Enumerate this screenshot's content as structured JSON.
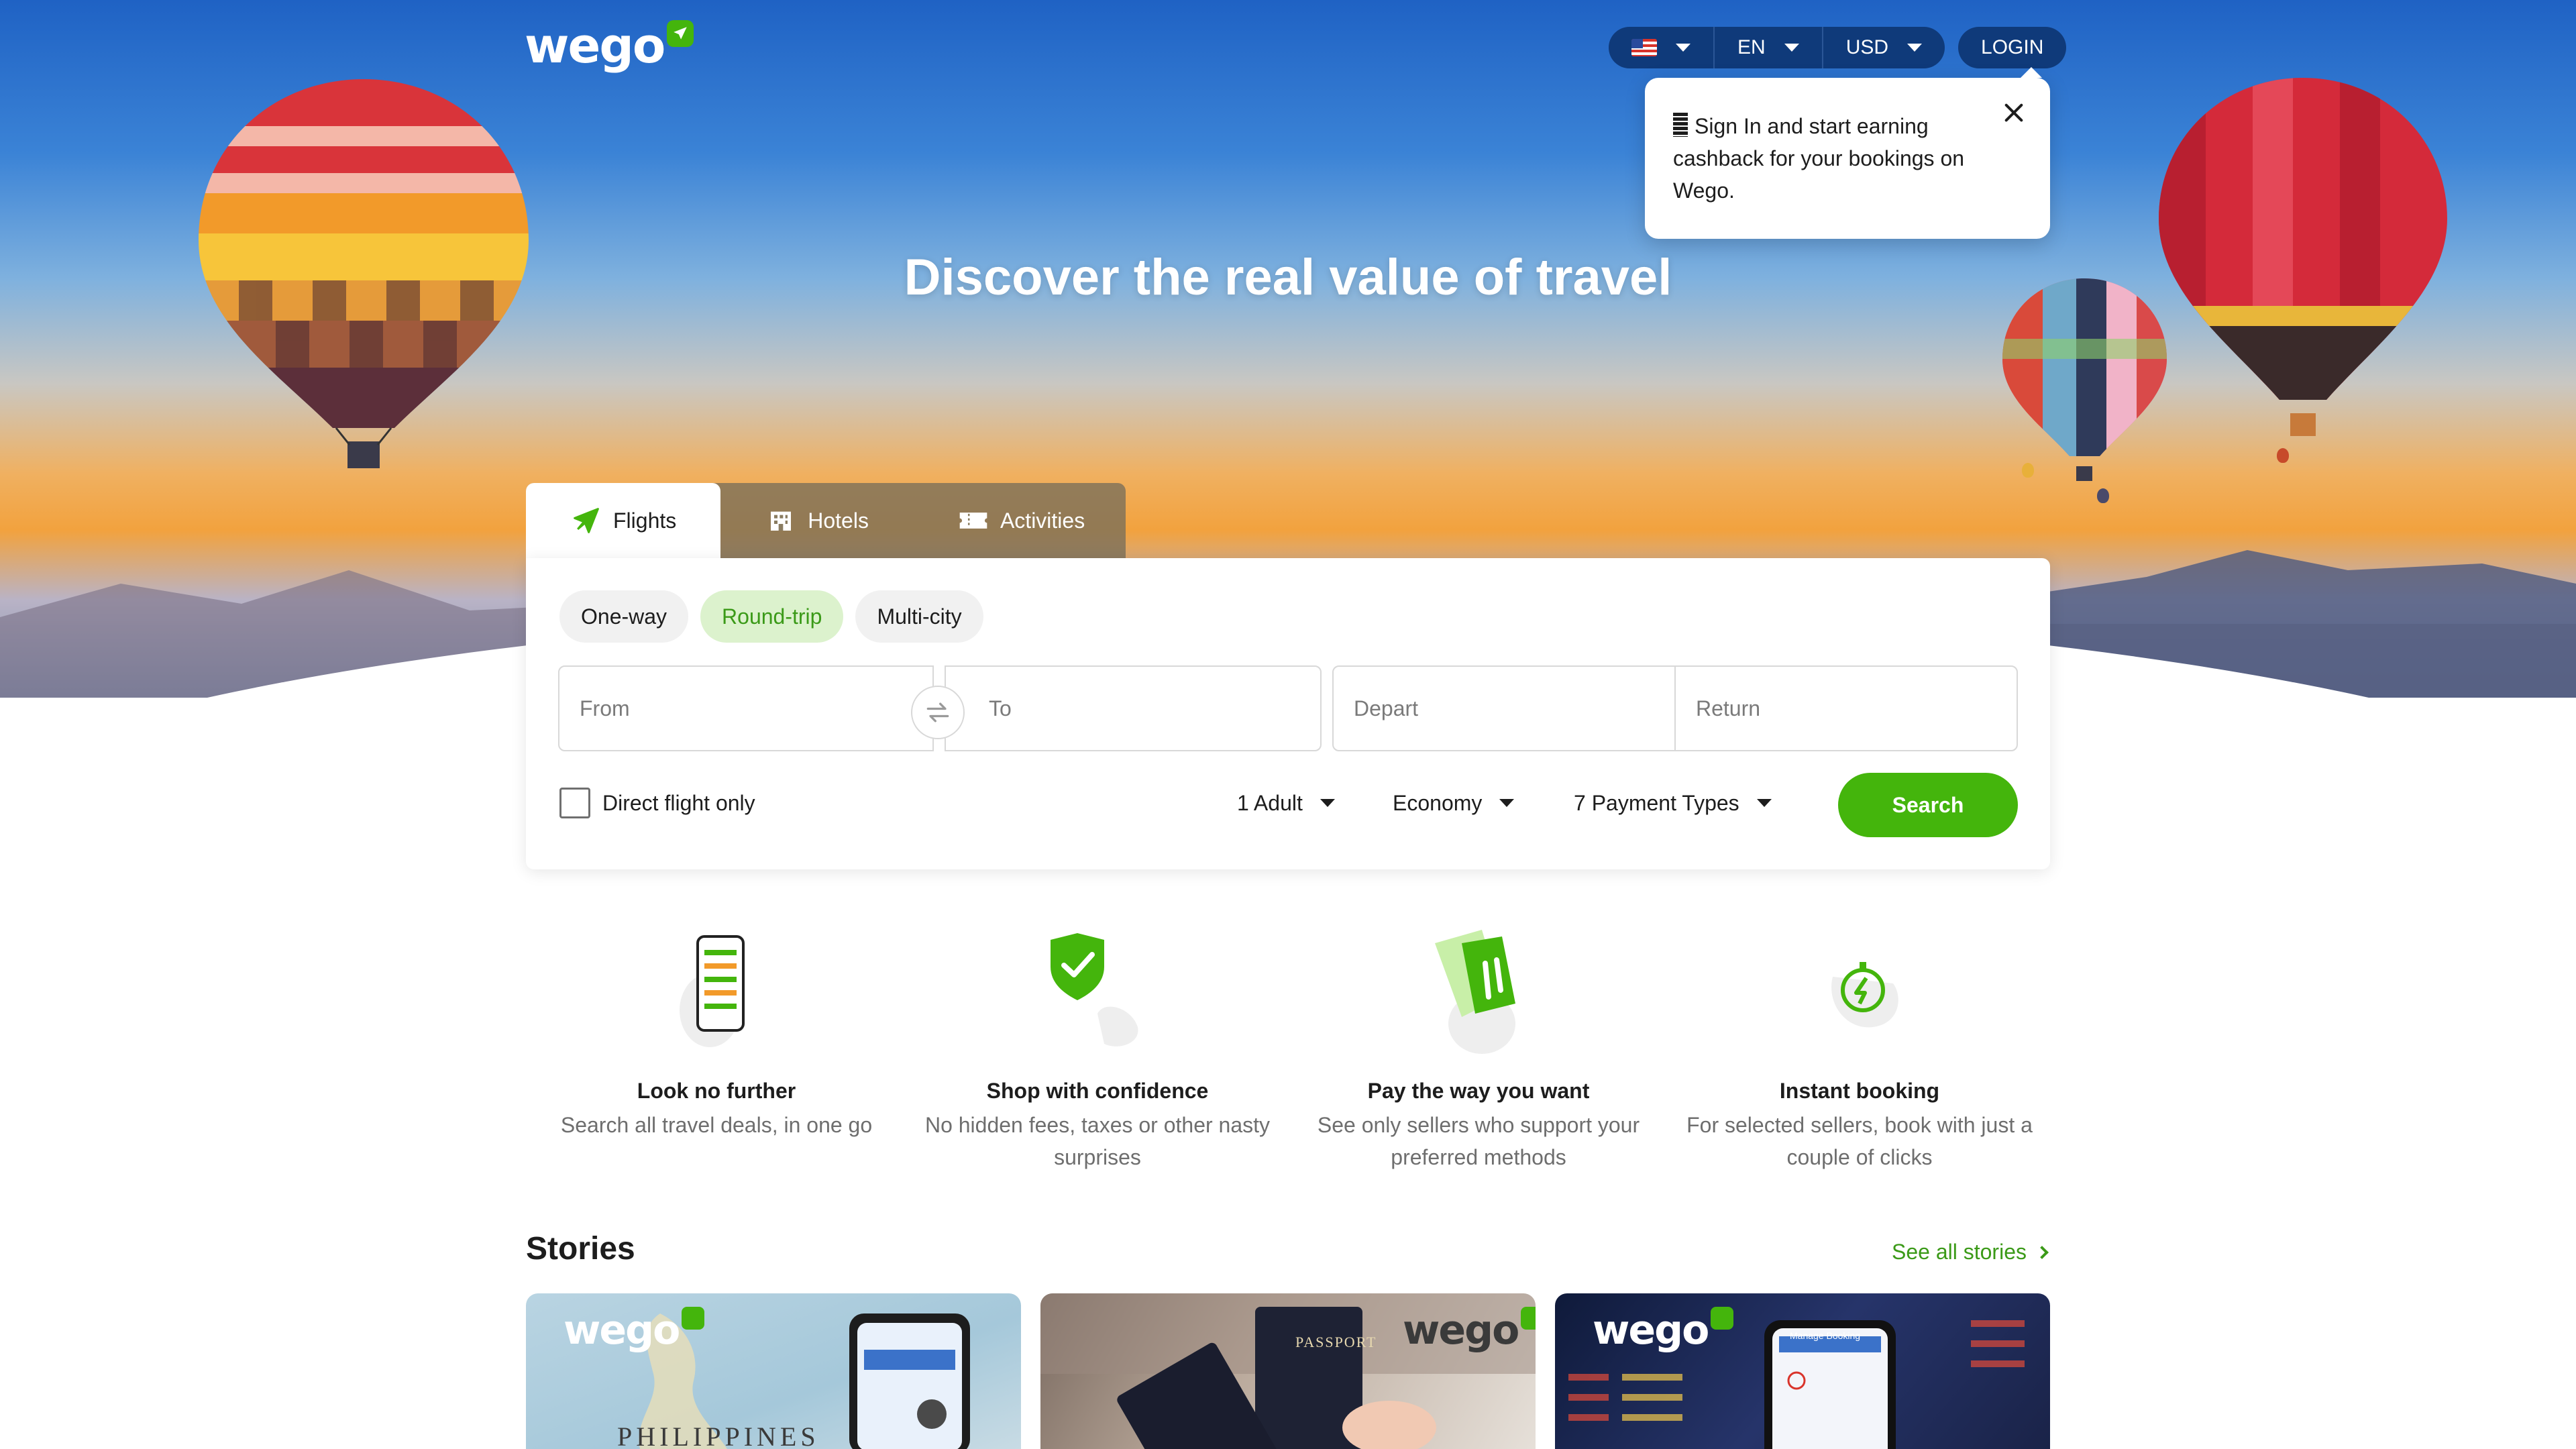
{
  "brand": {
    "logo_text": "wego"
  },
  "topbar": {
    "language": "EN",
    "currency": "USD",
    "login_label": "LOGIN"
  },
  "popover": {
    "message": "Sign In and start earning cashback for your bookings on Wego."
  },
  "hero": {
    "title": "Discover the real value of travel"
  },
  "search": {
    "tabs": [
      {
        "label": "Flights",
        "icon": "plane-icon",
        "active": true
      },
      {
        "label": "Hotels",
        "icon": "hotel-icon",
        "active": false
      },
      {
        "label": "Activities",
        "icon": "ticket-icon",
        "active": false
      }
    ],
    "trip_types": [
      {
        "label": "One-way",
        "active": false
      },
      {
        "label": "Round-trip",
        "active": true
      },
      {
        "label": "Multi-city",
        "active": false
      }
    ],
    "from_placeholder": "From",
    "to_placeholder": "To",
    "depart_placeholder": "Depart",
    "return_placeholder": "Return",
    "direct_label": "Direct flight only",
    "passengers": "1 Adult",
    "cabin_class": "Economy",
    "payment_types": "7 Payment Types",
    "search_label": "Search"
  },
  "features": [
    {
      "title": "Look no further",
      "desc": "Search all travel deals, in one go",
      "icon": "phone-list-icon"
    },
    {
      "title": "Shop with confidence",
      "desc": "No hidden fees, taxes or other nasty surprises",
      "icon": "shield-check-icon"
    },
    {
      "title": "Pay the way you want",
      "desc": "See only sellers who support your preferred methods",
      "icon": "card-hand-icon"
    },
    {
      "title": "Instant booking",
      "desc": "For selected sellers, book with just a couple of clicks",
      "icon": "lightning-timer-icon"
    }
  ],
  "stories": {
    "title": "Stories",
    "see_all": "See all stories",
    "cards": [
      {
        "image_text": "PHILIPPINES",
        "logo": "wego"
      },
      {
        "image_text": "PASSPORT",
        "logo": "wego"
      },
      {
        "image_text": "Manage Booking",
        "logo": "wego"
      }
    ]
  },
  "colors": {
    "brand_green": "#44b50c",
    "nav_dark_blue": "#0f3a7a",
    "active_pill_bg": "#dcf2cd",
    "active_pill_text": "#3b9a18"
  }
}
